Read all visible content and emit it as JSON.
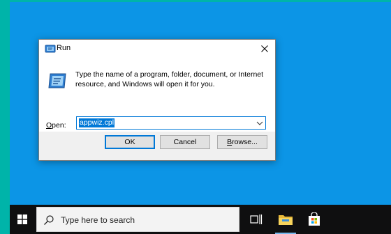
{
  "dialog": {
    "title": "Run",
    "description": "Type the name of a program, folder, document, or Internet resource, and Windows will open it for you.",
    "open_label_prefix": "",
    "open_label_underlined": "O",
    "open_label_rest": "pen:",
    "open_value": "appwiz.cpl",
    "ok_label": "OK",
    "cancel_label": "Cancel",
    "browse_prefix": "",
    "browse_underlined": "B",
    "browse_rest": "rowse..."
  },
  "taskbar": {
    "search_placeholder": "Type here to search"
  },
  "colors": {
    "desktop": "#0c95e6",
    "accent": "#0078d7",
    "taskbar": "#0f0f10",
    "frame": "#00b4a9"
  }
}
